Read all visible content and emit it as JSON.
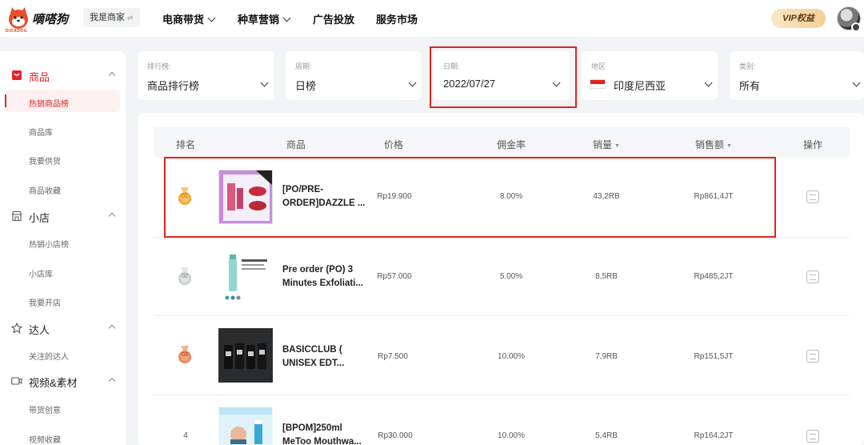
{
  "header": {
    "brand": "嘀嗒狗",
    "brand_sub": "DIDADOG",
    "role": "我是商家",
    "role_swap": "⇌",
    "nav": [
      "电商带货",
      "种草营销",
      "广告投放",
      "服务市场"
    ],
    "vip": "VIP权益"
  },
  "sidebar": {
    "groups": [
      {
        "label": "商品",
        "icon": "shopping-bag-icon",
        "items": [
          "热销商品榜",
          "商品库",
          "我要供货",
          "商品收藏"
        ]
      },
      {
        "label": "小店",
        "icon": "store-icon",
        "items": [
          "热销小店榜",
          "小店库",
          "我要开店"
        ]
      },
      {
        "label": "达人",
        "icon": "star-icon",
        "items": [
          "关注的达人"
        ]
      },
      {
        "label": "视频&素材",
        "icon": "video-icon",
        "items": [
          "带货创意",
          "视频收藏"
        ]
      }
    ],
    "active_item": "热销商品榜"
  },
  "filters": [
    {
      "label": "排行榜:",
      "value": "商品排行榜"
    },
    {
      "label": "周期:",
      "value": "日榜"
    },
    {
      "label": "日期:",
      "value": "2022/07/27"
    },
    {
      "label": "地区",
      "value": "印度尼西亚",
      "flag": "indonesia-flag-icon"
    },
    {
      "label": "类别:",
      "value": "所有"
    }
  ],
  "table": {
    "columns": [
      "排名",
      "商品",
      "价格",
      "佣金率",
      "销量",
      "销售额",
      "操作"
    ],
    "sort_indicator": "▼",
    "rows": [
      {
        "rank": "01",
        "name": "[PO/PRE-ORDER]DAZZLE ...",
        "price": "Rp19.900",
        "commission": "8.00%",
        "sales": "43,2RB",
        "revenue": "Rp861,4JT"
      },
      {
        "rank": "02",
        "name": "Pre order (PO) 3 Minutes Exfoliati...",
        "price": "Rp57.000",
        "commission": "5.00%",
        "sales": "8,5RB",
        "revenue": "Rp485,2JT"
      },
      {
        "rank": "03",
        "name": "BASICCLUB ( UNISEX EDT...",
        "price": "Rp7.500",
        "commission": "10.00%",
        "sales": "7,9RB",
        "revenue": "Rp151,5JT"
      },
      {
        "rank": "4",
        "name": "[BPOM]250ml MeToo Mouthwa...",
        "price": "Rp30.000",
        "commission": "10.00%",
        "sales": "5,4RB",
        "revenue": "Rp164,2JT"
      }
    ]
  },
  "colors": {
    "accent": "#e2231a",
    "gold": "#f4a62a",
    "silver": "#c9ccd2",
    "bronze": "#e9875a"
  }
}
